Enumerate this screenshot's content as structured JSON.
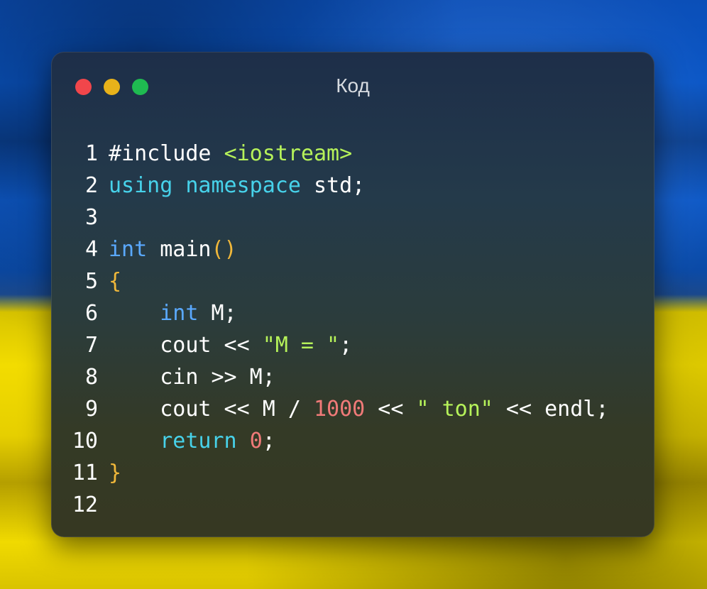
{
  "window": {
    "title": "Код",
    "controls": [
      "close-button",
      "minimize-button",
      "maximize-button"
    ]
  },
  "code": {
    "line_numbers": [
      "1",
      "2",
      "3",
      "4",
      "5",
      "6",
      "7",
      "8",
      "9",
      "10",
      "11",
      "12"
    ],
    "lines": [
      [
        {
          "t": "#include ",
          "c": "plain"
        },
        {
          "t": "<iostream>",
          "c": "str"
        }
      ],
      [
        {
          "t": "using",
          "c": "kw2"
        },
        {
          "t": " ",
          "c": "plain"
        },
        {
          "t": "namespace",
          "c": "kw2"
        },
        {
          "t": " std;",
          "c": "plain"
        }
      ],
      [],
      [
        {
          "t": "int",
          "c": "kw"
        },
        {
          "t": " main",
          "c": "plain"
        },
        {
          "t": "()",
          "c": "brace"
        }
      ],
      [
        {
          "t": "{",
          "c": "brace"
        }
      ],
      [
        {
          "t": "    ",
          "c": "plain"
        },
        {
          "t": "int",
          "c": "kw"
        },
        {
          "t": " M;",
          "c": "plain"
        }
      ],
      [
        {
          "t": "    cout << ",
          "c": "plain"
        },
        {
          "t": "\"M = \"",
          "c": "str"
        },
        {
          "t": ";",
          "c": "plain"
        }
      ],
      [
        {
          "t": "    cin >> M;",
          "c": "plain"
        }
      ],
      [
        {
          "t": "    cout << M / ",
          "c": "plain"
        },
        {
          "t": "1000",
          "c": "num"
        },
        {
          "t": " << ",
          "c": "plain"
        },
        {
          "t": "\" ton\"",
          "c": "str"
        },
        {
          "t": " << endl;",
          "c": "plain"
        }
      ],
      [
        {
          "t": "    ",
          "c": "plain"
        },
        {
          "t": "return",
          "c": "kw2"
        },
        {
          "t": " ",
          "c": "plain"
        },
        {
          "t": "0",
          "c": "num"
        },
        {
          "t": ";",
          "c": "plain"
        }
      ],
      [
        {
          "t": "}",
          "c": "brace"
        }
      ],
      []
    ]
  },
  "colors": {
    "keyword": "#5aa9ff",
    "keyword_alt": "#47d2ea",
    "string": "#b6f25a",
    "number": "#f07a78",
    "brace": "#f1b83a",
    "close": "#f1464b",
    "minimize": "#e8b21a",
    "maximize": "#1fbb51"
  }
}
